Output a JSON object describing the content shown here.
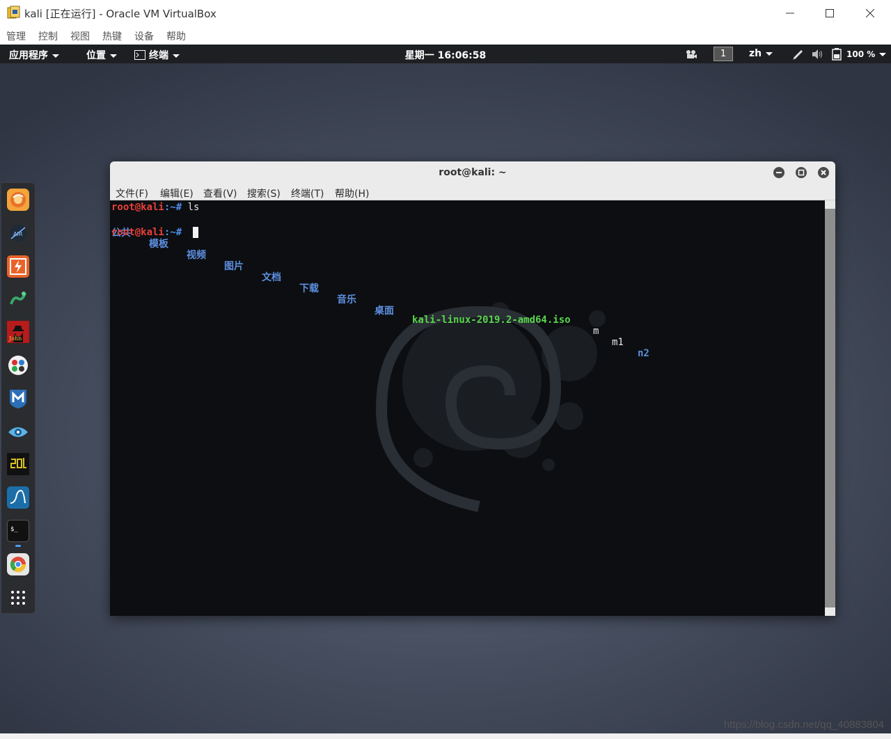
{
  "host": {
    "title": "kali [正在运行] - Oracle VM VirtualBox",
    "menu": [
      "管理",
      "控制",
      "视图",
      "热键",
      "设备",
      "帮助"
    ],
    "watermark": "https://blog.csdn.net/qq_40883804"
  },
  "topbar": {
    "applications": "应用程序",
    "places": "位置",
    "terminal": "终端",
    "clock": "星期一 16:06:58",
    "workspace": "1",
    "language": "zh",
    "battery": "100 %"
  },
  "dock": {
    "items": [
      "firefox-icon",
      "aircrack-icon",
      "burpsuite-icon",
      "hydra-icon",
      "john-icon",
      "maltego-icon",
      "metasploit-icon",
      "owasp-zap-icon",
      "sqlmap-icon",
      "wireshark-icon",
      "terminal-icon",
      "chromium-icon",
      "show-apps-icon"
    ]
  },
  "terminal": {
    "title": "root@kali: ~",
    "menu": [
      "文件(F)",
      "编辑(E)",
      "查看(V)",
      "搜索(S)",
      "终端(T)",
      "帮助(H)"
    ],
    "prompt_user": "root@kali",
    "prompt_path": ":~#",
    "command": "ls",
    "ls_dirs": [
      "公共",
      "模板",
      "视频",
      "图片",
      "文档",
      "下载",
      "音乐",
      "桌面"
    ],
    "ls_iso": "kali-linux-2019.2-amd64.iso",
    "ls_files": [
      "m",
      "m1"
    ],
    "ls_dir_last": "n2"
  }
}
